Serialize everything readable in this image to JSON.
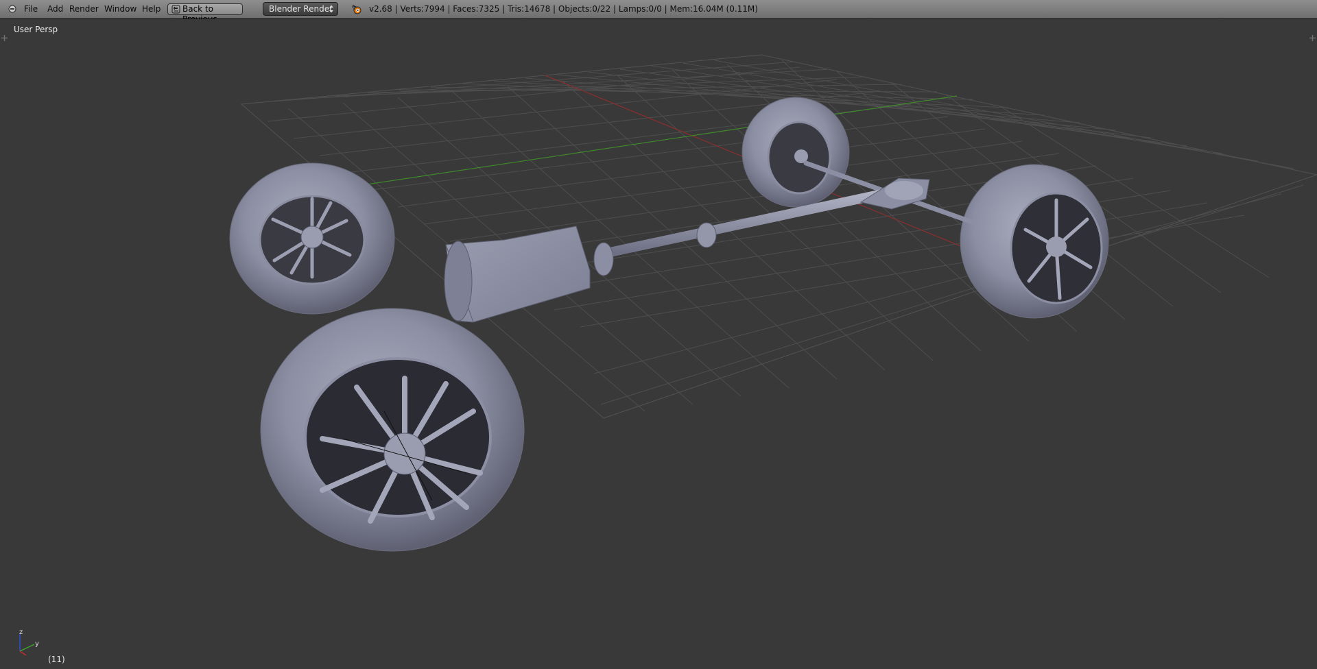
{
  "menu": {
    "items": [
      {
        "label": "File"
      },
      {
        "label": "Add"
      },
      {
        "label": "Render"
      },
      {
        "label": "Window"
      },
      {
        "label": "Help"
      }
    ],
    "back_button": "Back to Previous",
    "render_engine": "Blender Render"
  },
  "status": {
    "text": "v2.68 | Verts:7994 | Faces:7325 | Tris:14678 | Objects:0/22 | Lamps:0/0 | Mem:16.04M (0.11M)"
  },
  "viewport": {
    "view_label": "User Persp",
    "frame_label": "(11)",
    "axis_labels": {
      "z": "z",
      "y": "y"
    }
  },
  "colors": {
    "background": "#393939",
    "grid": "#4e4e4e",
    "x_axis": "#8a2e2e",
    "y_axis": "#3f8a2b",
    "mesh": "#8c8fa3"
  },
  "icons": {
    "editor": "editor-type-icon",
    "back": "back-arrow-icon",
    "logo": "blender-logo-icon"
  }
}
